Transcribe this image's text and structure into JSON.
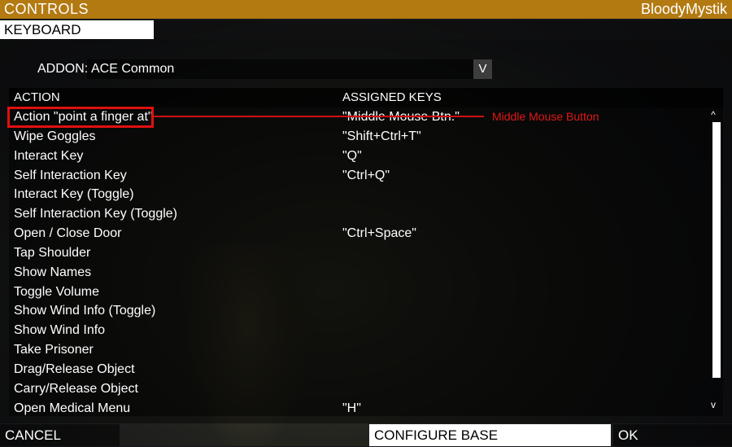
{
  "window": {
    "title": "CONTROLS",
    "username": "BloodyMystik"
  },
  "tabs": [
    {
      "label": "KEYBOARD",
      "active": true
    }
  ],
  "addon": {
    "label": "ADDON:",
    "selected": "ACE Common",
    "dropdown_glyph": "V"
  },
  "list": {
    "headers": {
      "action": "ACTION",
      "keys": "ASSIGNED KEYS"
    },
    "rows": [
      {
        "action": "Action \"point a finger at\"",
        "keys": "\"Middle Mouse Btn.\""
      },
      {
        "action": "Wipe Goggles",
        "keys": "\"Shift+Ctrl+T\""
      },
      {
        "action": "Interact Key",
        "keys": "\"Q\""
      },
      {
        "action": "Self Interaction Key",
        "keys": "\"Ctrl+Q\""
      },
      {
        "action": "Interact Key (Toggle)",
        "keys": ""
      },
      {
        "action": "Self Interaction Key (Toggle)",
        "keys": ""
      },
      {
        "action": "Open / Close Door",
        "keys": "\"Ctrl+Space\""
      },
      {
        "action": "Tap Shoulder",
        "keys": ""
      },
      {
        "action": "Show Names",
        "keys": ""
      },
      {
        "action": "Toggle Volume",
        "keys": ""
      },
      {
        "action": "Show Wind Info (Toggle)",
        "keys": ""
      },
      {
        "action": "Show Wind Info",
        "keys": ""
      },
      {
        "action": "Take Prisoner",
        "keys": ""
      },
      {
        "action": "Drag/Release Object",
        "keys": ""
      },
      {
        "action": "Carry/Release Object",
        "keys": ""
      },
      {
        "action": "Open Medical Menu",
        "keys": "\"H\""
      }
    ],
    "scroll_up_glyph": "^",
    "scroll_down_glyph": "v"
  },
  "annotation": {
    "text": "Middle Mouse Button",
    "color": "#e01818"
  },
  "buttons": {
    "cancel": "CANCEL",
    "configure_base": "CONFIGURE BASE",
    "ok": "OK"
  },
  "colors": {
    "title_bar": "#b37a12",
    "highlight": "#e01010"
  }
}
